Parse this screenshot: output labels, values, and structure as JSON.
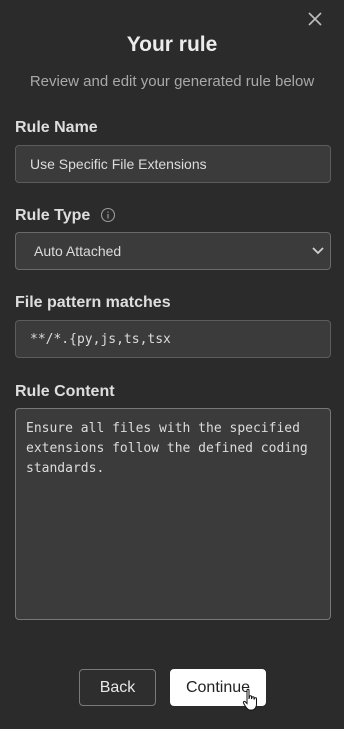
{
  "dialog": {
    "title": "Your rule",
    "subtitle": "Review and edit your generated rule below"
  },
  "rule_name": {
    "label": "Rule Name",
    "value": "Use Specific File Extensions"
  },
  "rule_type": {
    "label": "Rule Type",
    "selected": "Auto Attached",
    "icon": "info-icon"
  },
  "file_pattern": {
    "label": "File pattern matches",
    "value": "**/*.{py,js,ts,tsx"
  },
  "rule_content": {
    "label": "Rule Content",
    "value": "Ensure all files with the specified\nextensions follow the defined coding\nstandards."
  },
  "buttons": {
    "back": "Back",
    "continue": "Continue"
  }
}
